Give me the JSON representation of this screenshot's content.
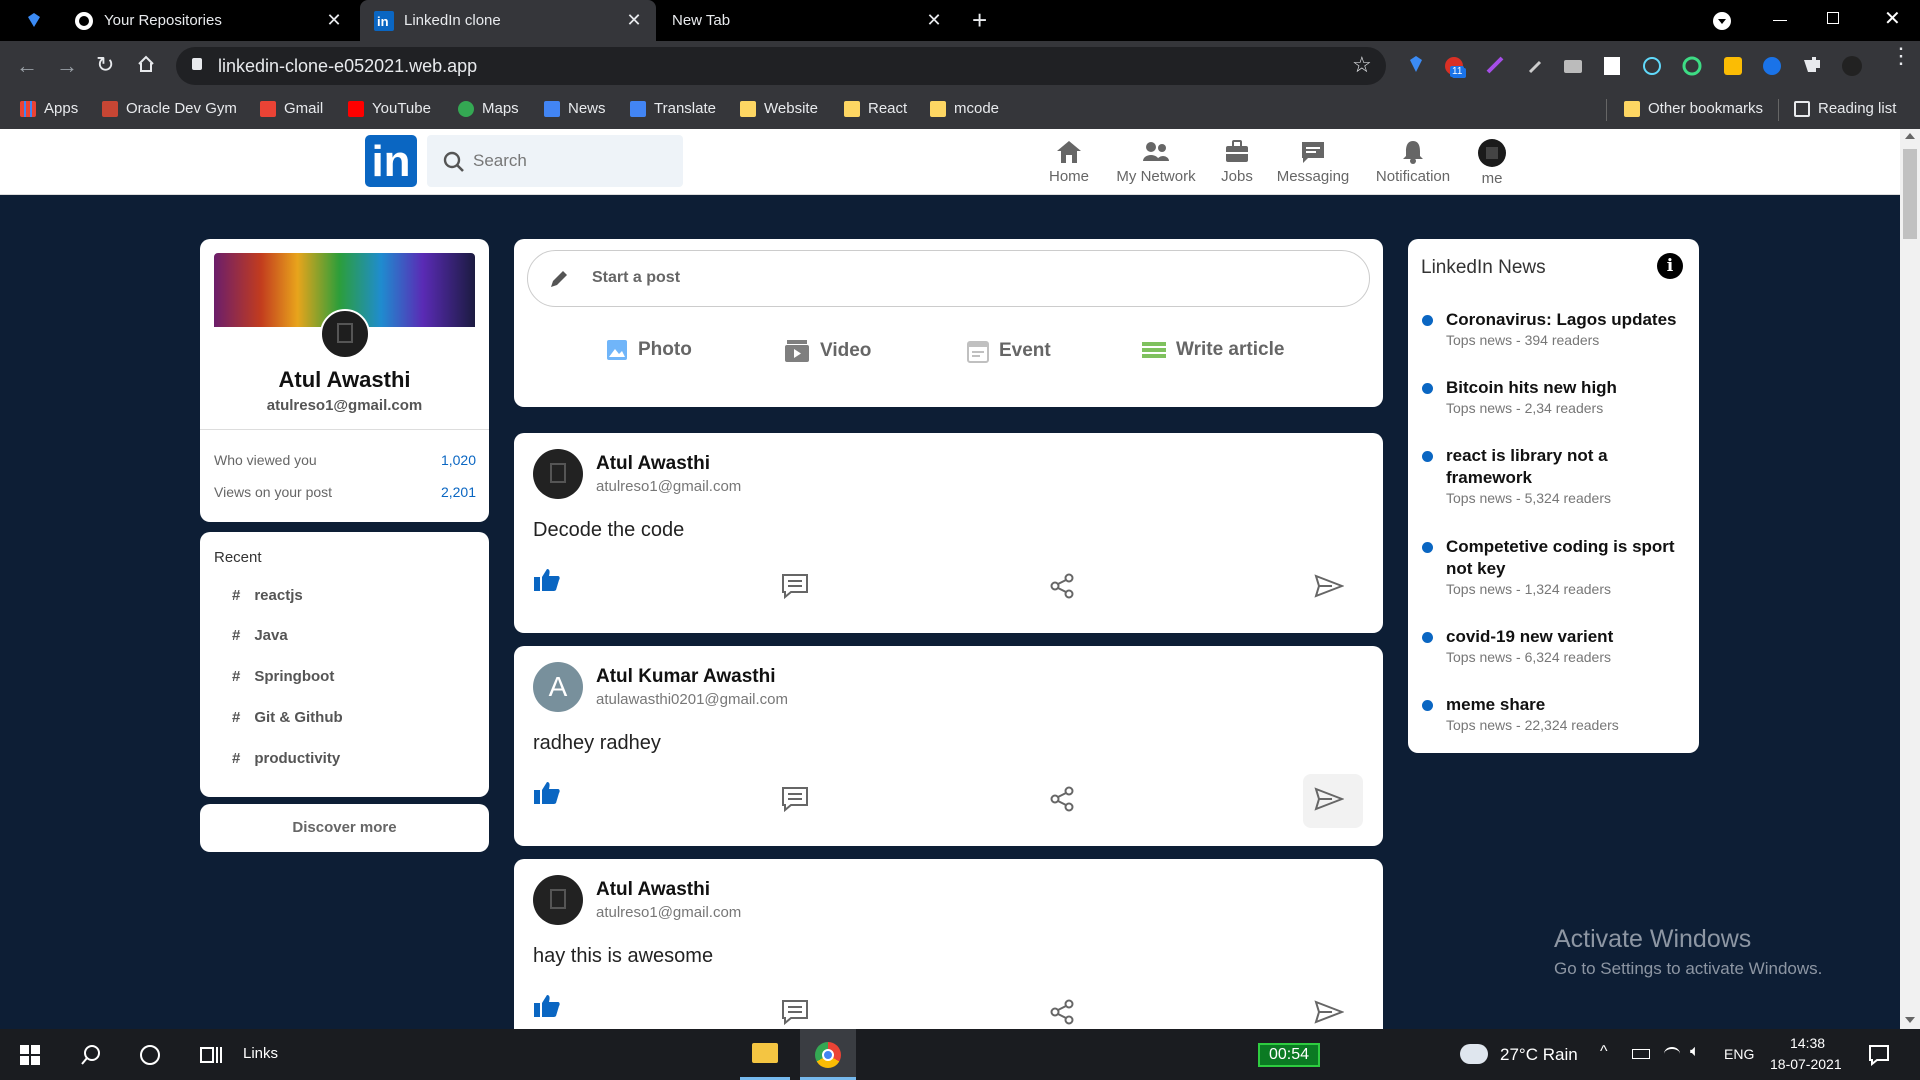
{
  "browser": {
    "tabs": [
      {
        "label": "Your Repositories",
        "active": false
      },
      {
        "label": "LinkedIn clone",
        "active": true
      },
      {
        "label": "New Tab",
        "active": false
      }
    ],
    "new_tab": "+",
    "url": "linkedin-clone-e052021.web.app",
    "bookmarks": [
      "Apps",
      "Oracle Dev Gym",
      "Gmail",
      "YouTube",
      "Maps",
      "News",
      "Translate",
      "Website",
      "React",
      "mcode"
    ],
    "other_bookmarks": "Other bookmarks",
    "reading_list": "Reading list",
    "ext_badge": "11"
  },
  "header": {
    "logo": "in",
    "search_placeholder": "Search",
    "nav": [
      {
        "label": "Home",
        "icon": "home-icon"
      },
      {
        "label": "My Network",
        "icon": "network-icon"
      },
      {
        "label": "Jobs",
        "icon": "jobs-icon"
      },
      {
        "label": "Messaging",
        "icon": "messaging-icon"
      },
      {
        "label": "Notification",
        "icon": "bell-icon"
      },
      {
        "label": "me",
        "icon": "avatar"
      }
    ]
  },
  "profile": {
    "name": "Atul Awasthi",
    "email": "atulreso1@gmail.com",
    "stats": [
      {
        "label": "Who viewed you",
        "value": "1,020"
      },
      {
        "label": "Views on your post",
        "value": "2,201"
      }
    ]
  },
  "recent": {
    "title": "Recent",
    "items": [
      "reactjs",
      "Java",
      "Springboot",
      "Git & Github",
      "productivity"
    ],
    "hash": "#"
  },
  "discover": "Discover more",
  "composer": {
    "placeholder": "Start a post",
    "options": [
      {
        "label": "Photo",
        "color": "#70b5f9"
      },
      {
        "label": "Video",
        "color": "#7f7f7f"
      },
      {
        "label": "Event",
        "color": "#c0c0c0"
      },
      {
        "label": "Write article",
        "color": "#7fc15e"
      }
    ]
  },
  "posts": [
    {
      "author": "Atul Awasthi",
      "email": "atulreso1@gmail.com",
      "message": "Decode the code",
      "avatar_letter": ""
    },
    {
      "author": "Atul Kumar Awasthi",
      "email": "atulawasthi0201@gmail.com",
      "message": "radhey radhey",
      "avatar_letter": "A"
    },
    {
      "author": "Atul Awasthi",
      "email": "atulreso1@gmail.com",
      "message": "hay this is awesome",
      "avatar_letter": ""
    }
  ],
  "news": {
    "title": "LinkedIn News",
    "items": [
      {
        "headline": "Coronavirus: Lagos updates",
        "meta": "Tops news - 394 readers"
      },
      {
        "headline": "Bitcoin hits new high",
        "meta": "Tops news - 2,34 readers"
      },
      {
        "headline": "react is library not a framework",
        "meta": "Tops news - 5,324 readers"
      },
      {
        "headline": "Competetive coding is sport not key",
        "meta": "Tops news - 1,324 readers"
      },
      {
        "headline": "covid-19 new varient",
        "meta": "Tops news - 6,324 readers"
      },
      {
        "headline": "meme share",
        "meta": "Tops news - 22,324 readers"
      }
    ]
  },
  "watermark": {
    "title": "Activate Windows",
    "subtitle": "Go to Settings to activate Windows."
  },
  "taskbar": {
    "links": "Links",
    "timer": "00:54",
    "weather": "27°C  Rain",
    "lang": "ENG",
    "time": "14:38",
    "date": "18-07-2021"
  },
  "colors": {
    "accent": "#0a66c2",
    "page_bg": "#0d1e35"
  }
}
